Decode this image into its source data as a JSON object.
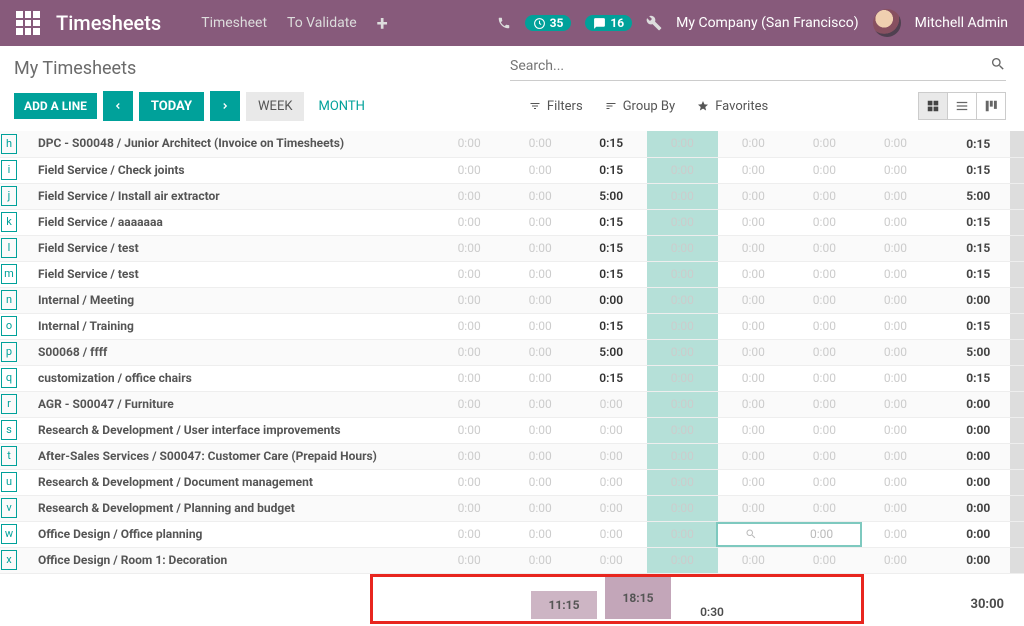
{
  "nav": {
    "brand": "Timesheets",
    "timesheet": "Timesheet",
    "to_validate": "To Validate",
    "clock_badge": "35",
    "chat_badge": "16",
    "company": "My Company (San Francisco)",
    "user": "Mitchell Admin"
  },
  "page": {
    "title": "My Timesheets",
    "search_placeholder": "Search..."
  },
  "tools": {
    "add_line": "ADD A LINE",
    "today": "TODAY",
    "week": "WEEK",
    "month": "MONTH",
    "filters": "Filters",
    "group_by": "Group By",
    "favorites": "Favorites"
  },
  "rows": [
    {
      "l": "h",
      "name": "DPC - S00048 / Junior Architect (Invoice on Timesheets)",
      "cells": [
        "0:00",
        "0:00",
        "0:15",
        "0:00",
        "0:00",
        "0:00",
        "0:00"
      ],
      "valIdx": 2,
      "total": "0:15"
    },
    {
      "l": "i",
      "name": "Field Service / Check joints",
      "cells": [
        "0:00",
        "0:00",
        "0:15",
        "0:00",
        "0:00",
        "0:00",
        "0:00"
      ],
      "valIdx": 2,
      "total": "0:15"
    },
    {
      "l": "j",
      "name": "Field Service / Install air extractor",
      "cells": [
        "0:00",
        "0:00",
        "5:00",
        "0:00",
        "0:00",
        "0:00",
        "0:00"
      ],
      "valIdx": 2,
      "total": "5:00"
    },
    {
      "l": "k",
      "name": "Field Service / aaaaaaa",
      "cells": [
        "0:00",
        "0:00",
        "0:15",
        "0:00",
        "0:00",
        "0:00",
        "0:00"
      ],
      "valIdx": 2,
      "total": "0:15"
    },
    {
      "l": "l",
      "name": "Field Service / test",
      "cells": [
        "0:00",
        "0:00",
        "0:15",
        "0:00",
        "0:00",
        "0:00",
        "0:00"
      ],
      "valIdx": 2,
      "total": "0:15"
    },
    {
      "l": "m",
      "name": "Field Service / test",
      "cells": [
        "0:00",
        "0:00",
        "0:15",
        "0:00",
        "0:00",
        "0:00",
        "0:00"
      ],
      "valIdx": 2,
      "total": "0:15"
    },
    {
      "l": "n",
      "name": "Internal / Meeting",
      "cells": [
        "0:00",
        "0:00",
        "0:00",
        "0:00",
        "0:00",
        "0:00",
        "0:00"
      ],
      "valIdx": 2,
      "total": "0:00"
    },
    {
      "l": "o",
      "name": "Internal / Training",
      "cells": [
        "0:00",
        "0:00",
        "0:15",
        "0:00",
        "0:00",
        "0:00",
        "0:00"
      ],
      "valIdx": 2,
      "total": "0:15"
    },
    {
      "l": "p",
      "name": "S00068 / ffff",
      "cells": [
        "0:00",
        "0:00",
        "5:00",
        "0:00",
        "0:00",
        "0:00",
        "0:00"
      ],
      "valIdx": 2,
      "total": "5:00"
    },
    {
      "l": "q",
      "name": "customization / office chairs",
      "cells": [
        "0:00",
        "0:00",
        "0:15",
        "0:00",
        "0:00",
        "0:00",
        "0:00"
      ],
      "valIdx": 2,
      "total": "0:15"
    },
    {
      "l": "r",
      "name": "AGR - S00047 / Furniture",
      "cells": [
        "0:00",
        "0:00",
        "0:00",
        "0:00",
        "0:00",
        "0:00",
        "0:00"
      ],
      "valIdx": -1,
      "total": "0:00"
    },
    {
      "l": "s",
      "name": "Research & Development / User interface improvements",
      "cells": [
        "0:00",
        "0:00",
        "0:00",
        "0:00",
        "0:00",
        "0:00",
        "0:00"
      ],
      "valIdx": -1,
      "total": "0:00"
    },
    {
      "l": "t",
      "name": "After-Sales Services / S00047: Customer Care (Prepaid Hours)",
      "cells": [
        "0:00",
        "0:00",
        "0:00",
        "0:00",
        "0:00",
        "0:00",
        "0:00"
      ],
      "valIdx": -1,
      "total": "0:00"
    },
    {
      "l": "u",
      "name": "Research & Development / Document management",
      "cells": [
        "0:00",
        "0:00",
        "0:00",
        "0:00",
        "0:00",
        "0:00",
        "0:00"
      ],
      "valIdx": -1,
      "total": "0:00"
    },
    {
      "l": "v",
      "name": "Research & Development / Planning and budget",
      "cells": [
        "0:00",
        "0:00",
        "0:00",
        "0:00",
        "0:00",
        "0:00",
        "0:00"
      ],
      "valIdx": -1,
      "total": "0:00"
    },
    {
      "l": "w",
      "name": "Office Design / Office planning",
      "cells": [
        "0:00",
        "0:00",
        "0:00",
        "0:00",
        "0:00",
        "0:00",
        "0:00"
      ],
      "valIdx": -1,
      "total": "0:00",
      "editing": true,
      "editCells": [
        "0:00",
        "0:00"
      ]
    },
    {
      "l": "x",
      "name": "Office Design / Room 1: Decoration",
      "cells": [
        "0:00",
        "0:00",
        "0:00",
        "0:00",
        "0:00",
        "0:00",
        "0:00"
      ],
      "valIdx": -1,
      "total": "0:00"
    }
  ],
  "footer": {
    "bar1": "11:15",
    "bar2": "18:15",
    "val3": "0:30",
    "total": "30:00"
  },
  "icons": {
    "search": "search-icon",
    "zoom": "zoom-icon"
  }
}
